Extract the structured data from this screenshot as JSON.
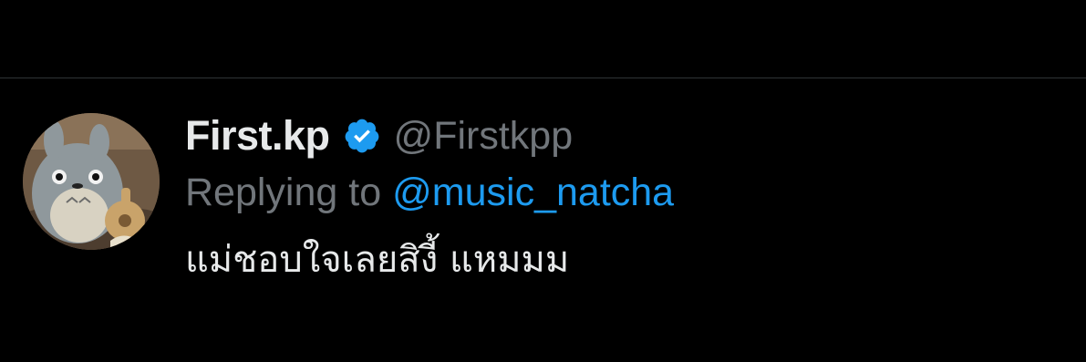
{
  "tweet": {
    "author": {
      "display_name": "First.kp",
      "handle": "@Firstkpp",
      "verified": true,
      "avatar_icon": "totoro-avatar"
    },
    "reply": {
      "label": "Replying to",
      "mention": "@music_natcha"
    },
    "text": "แม่ชอบใจเลยสิงี้ แหมมม"
  },
  "colors": {
    "background": "#000000",
    "primary_text": "#e7e9ea",
    "secondary_text": "#71767b",
    "accent": "#1d9bf0",
    "divider": "#2f3336"
  }
}
